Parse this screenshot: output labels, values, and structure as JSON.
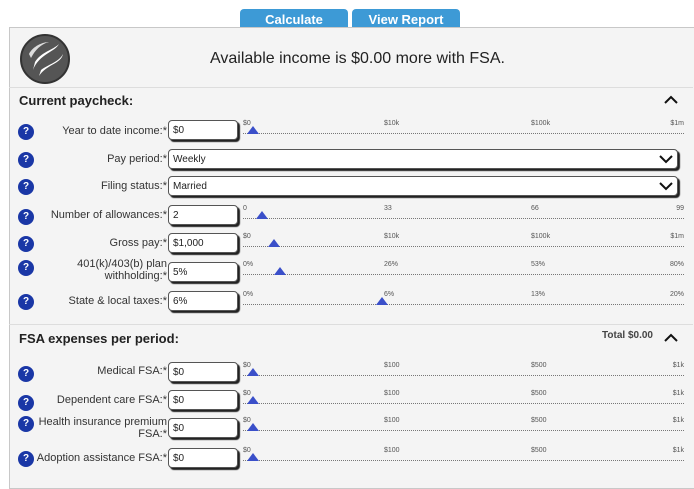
{
  "top_buttons": {
    "calculate": "Calculate",
    "view_report": "View Report"
  },
  "headline": "Available income is $0.00 more with FSA.",
  "sections": {
    "paycheck": {
      "title": "Current paycheck:"
    },
    "fsa": {
      "title": "FSA expenses per period:",
      "total": "Total $0.00"
    }
  },
  "help_glyph": "?",
  "fields": {
    "ytd_income": {
      "label": "Year to date income:*",
      "value": "$0",
      "ticks": [
        "$0",
        "$10k",
        "$100k",
        "$1m"
      ],
      "slider_fraction": 0.0
    },
    "pay_period": {
      "label": "Pay period:*",
      "value": "Weekly"
    },
    "filing_status": {
      "label": "Filing status:*",
      "value": "Married"
    },
    "allowances": {
      "label": "Number of allowances:*",
      "value": "2",
      "ticks": [
        "0",
        "33",
        "66",
        "99"
      ],
      "slider_fraction": 0.02
    },
    "gross_pay": {
      "label": "Gross pay:*",
      "value": "$1,000",
      "ticks": [
        "$0",
        "$10k",
        "$100k",
        "$1m"
      ],
      "slider_fraction": 0.05
    },
    "plan_withholding": {
      "label": "401(k)/403(b) plan withholding:*",
      "value": "5%",
      "ticks": [
        "0%",
        "26%",
        "53%",
        "80%"
      ],
      "slider_fraction": 0.0625
    },
    "state_taxes": {
      "label": "State & local taxes:*",
      "value": "6%",
      "ticks": [
        "0%",
        "6%",
        "13%",
        "20%"
      ],
      "slider_fraction": 0.3
    },
    "medical_fsa": {
      "label": "Medical FSA:*",
      "value": "$0",
      "ticks": [
        "$0",
        "$100",
        "$500",
        "$1k"
      ],
      "slider_fraction": 0.0
    },
    "dependent_care_fsa": {
      "label": "Dependent care FSA:*",
      "value": "$0",
      "ticks": [
        "$0",
        "$100",
        "$500",
        "$1k"
      ],
      "slider_fraction": 0.0
    },
    "health_insurance_fsa": {
      "label": "Health insurance premium FSA:*",
      "value": "$0",
      "ticks": [
        "$0",
        "$100",
        "$500",
        "$1k"
      ],
      "slider_fraction": 0.0
    },
    "adoption_fsa": {
      "label": "Adoption assistance FSA:*",
      "value": "$0",
      "ticks": [
        "$0",
        "$100",
        "$500",
        "$1k"
      ],
      "slider_fraction": 0.0
    }
  },
  "colors": {
    "button": "#3d9ad6",
    "help": "#1a37a6",
    "thumb": "#3a4fc9"
  }
}
